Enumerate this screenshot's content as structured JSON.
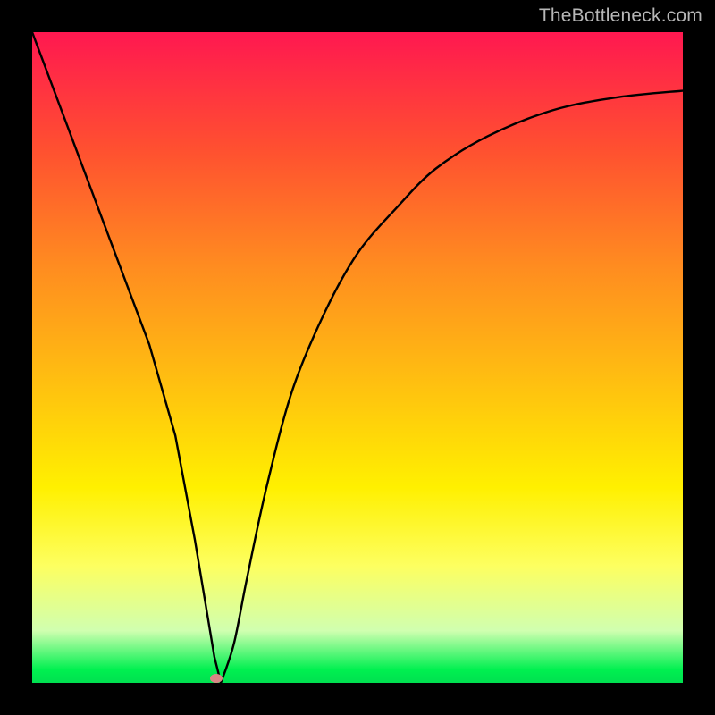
{
  "watermark": "TheBottleneck.com",
  "chart_data": {
    "type": "line",
    "title": "",
    "xlabel": "",
    "ylabel": "",
    "xlim": [
      0,
      100
    ],
    "ylim": [
      0,
      100
    ],
    "series": [
      {
        "name": "curve",
        "x": [
          0,
          6,
          12,
          18,
          22,
          25,
          27,
          28,
          29,
          31,
          33,
          36,
          40,
          45,
          50,
          56,
          62,
          70,
          80,
          90,
          100
        ],
        "values": [
          100,
          84,
          68,
          52,
          38,
          22,
          10,
          4,
          0,
          6,
          16,
          30,
          45,
          57,
          66,
          73,
          79,
          84,
          88,
          90,
          91
        ]
      }
    ],
    "marker": {
      "x": 28.3,
      "y": 0.7
    },
    "background_gradient": {
      "stops": [
        {
          "pos": 0.0,
          "color": "#ff1850"
        },
        {
          "pos": 0.18,
          "color": "#ff5030"
        },
        {
          "pos": 0.36,
          "color": "#ff8c20"
        },
        {
          "pos": 0.54,
          "color": "#ffc010"
        },
        {
          "pos": 0.7,
          "color": "#fff000"
        },
        {
          "pos": 0.82,
          "color": "#fdff60"
        },
        {
          "pos": 0.92,
          "color": "#d0ffb0"
        },
        {
          "pos": 0.98,
          "color": "#00f050"
        },
        {
          "pos": 1.0,
          "color": "#00e050"
        }
      ]
    }
  }
}
